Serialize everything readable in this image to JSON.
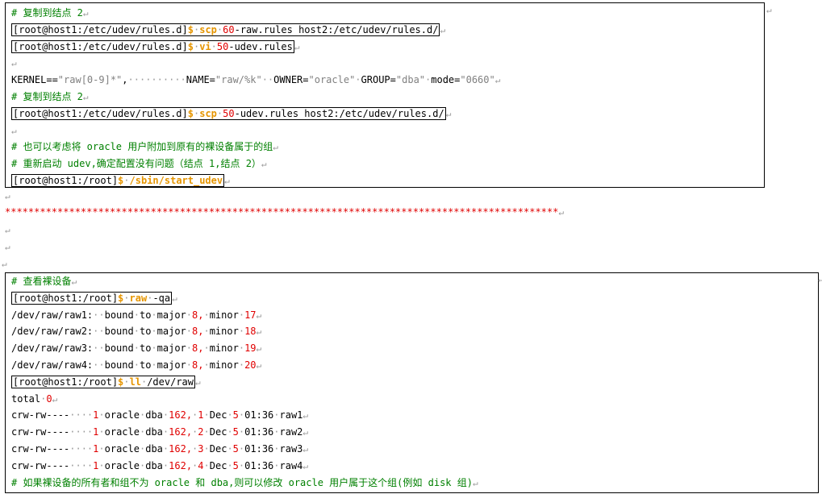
{
  "box1": {
    "lines": [
      {
        "type": "comment",
        "text": "# 复制到结点 2"
      },
      {
        "type": "cmd",
        "prompt": "[root@host1:/etc/udev/rules.d]",
        "sym": "$",
        "cmd": "scp",
        "n": "60",
        "rest": "-raw.rules host2:/etc/udev/rules.d/"
      },
      {
        "type": "cmd",
        "prompt": "[root@host1:/etc/udev/rules.d]",
        "sym": "$",
        "cmd": "vi",
        "n": "50",
        "rest": "-udev.rules"
      },
      {
        "type": "blank"
      },
      {
        "type": "kernel",
        "k1": "KERNEL==",
        "v1": "\"raw[0-9]*\"",
        "k2": "NAME=",
        "v2": "\"raw/%k\"",
        "k3": "OWNER=",
        "v3": "\"oracle\"",
        "k4": "GROUP=",
        "v4": "\"dba\"",
        "k5": "mode=",
        "v5": "\"0660\""
      },
      {
        "type": "comment",
        "text": "# 复制到结点 2"
      },
      {
        "type": "cmd",
        "prompt": "[root@host1:/etc/udev/rules.d]",
        "sym": "$",
        "cmd": "scp",
        "n": "50",
        "rest": "-udev.rules host2:/etc/udev/rules.d/"
      },
      {
        "type": "blank"
      },
      {
        "type": "comment",
        "text": "# 也可以考虑将 oracle 用户附加到原有的裸设备属于的组"
      },
      {
        "type": "comment",
        "text": "# 重新启动 udev,确定配置没有问题（结点 1,结点 2）"
      },
      {
        "type": "cmd2",
        "prompt": "[root@host1:/root]",
        "sym": "$",
        "cmd": "/sbin/start_udev"
      }
    ]
  },
  "separator": "***********************************************************************************************",
  "box2": {
    "lines": [
      {
        "type": "comment",
        "text": "# 查看裸设备"
      },
      {
        "type": "cmd3",
        "prompt": "[root@host1:/root]",
        "sym": "$",
        "cmd": "raw",
        "rest": "-qa"
      },
      {
        "type": "raw",
        "dev": "/dev/raw/raw1:",
        "txt": "bound to major",
        "maj": "8,",
        "mintxt": "minor",
        "min": "17"
      },
      {
        "type": "raw",
        "dev": "/dev/raw/raw2:",
        "txt": "bound to major",
        "maj": "8,",
        "mintxt": "minor",
        "min": "18"
      },
      {
        "type": "raw",
        "dev": "/dev/raw/raw3:",
        "txt": "bound to major",
        "maj": "8,",
        "mintxt": "minor",
        "min": "19"
      },
      {
        "type": "raw",
        "dev": "/dev/raw/raw4:",
        "txt": "bound to major",
        "maj": "8,",
        "mintxt": "minor",
        "min": "20"
      },
      {
        "type": "cmd3",
        "prompt": "[root@host1:/root]",
        "sym": "$",
        "cmd": "ll",
        "rest": "/dev/raw"
      },
      {
        "type": "total",
        "txt": "total",
        "n": "0"
      },
      {
        "type": "ls",
        "perm": "crw-rw----",
        "links": "1",
        "user": "oracle",
        "grp": "dba",
        "maj": "162,",
        "min": "1",
        "mon": "Dec",
        "day": "5",
        "time": "01:36",
        "name": "raw1"
      },
      {
        "type": "ls",
        "perm": "crw-rw----",
        "links": "1",
        "user": "oracle",
        "grp": "dba",
        "maj": "162,",
        "min": "2",
        "mon": "Dec",
        "day": "5",
        "time": "01:36",
        "name": "raw2"
      },
      {
        "type": "ls",
        "perm": "crw-rw----",
        "links": "1",
        "user": "oracle",
        "grp": "dba",
        "maj": "162,",
        "min": "3",
        "mon": "Dec",
        "day": "5",
        "time": "01:36",
        "name": "raw3"
      },
      {
        "type": "ls",
        "perm": "crw-rw----",
        "links": "1",
        "user": "oracle",
        "grp": "dba",
        "maj": "162,",
        "min": "4",
        "mon": "Dec",
        "day": "5",
        "time": "01:36",
        "name": "raw4"
      },
      {
        "type": "comment",
        "text": "# 如果裸设备的所有者和组不为 oracle 和 dba,则可以修改 oracle 用户属于这个组(例如 disk 组)"
      }
    ]
  },
  "para_mark": "↵"
}
